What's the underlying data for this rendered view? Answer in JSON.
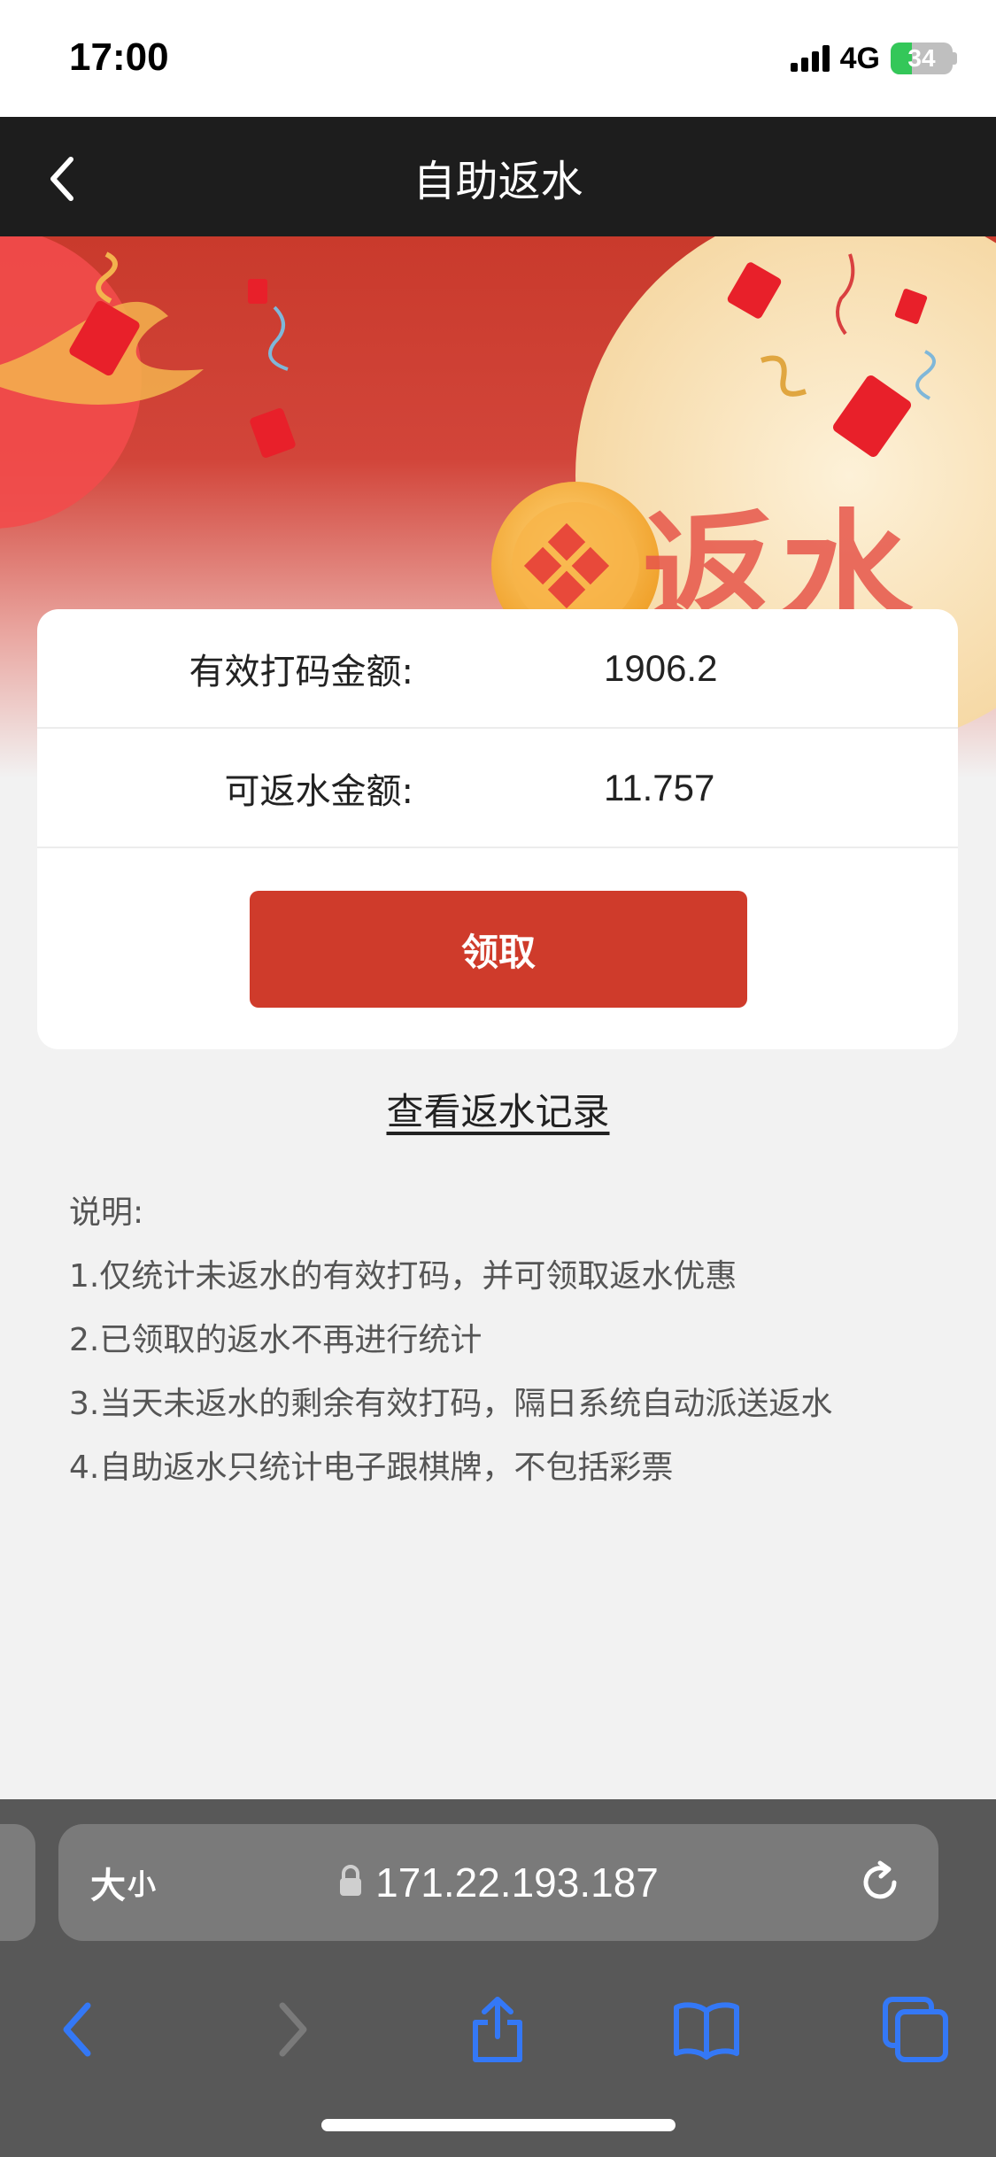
{
  "status_bar": {
    "time": "17:00",
    "network": "4G",
    "battery": "34",
    "battery_level": 0.34
  },
  "nav": {
    "title": "自助返水"
  },
  "banner": {
    "headline": "返水"
  },
  "card": {
    "rows": [
      {
        "label": "有效打码金额:",
        "value": "1906.2"
      },
      {
        "label": "可返水金额:",
        "value": "11.757"
      }
    ],
    "claim_label": "领取"
  },
  "records_link": "查看返水记录",
  "notes": {
    "title": "说明:",
    "items": [
      "1.仅统计未返水的有效打码，并可领取返水优惠",
      "2.已领取的返水不再进行统计",
      "3.当天未返水的剩余有效打码，隔日系统自动派送返水",
      "4.自助返水只统计电子跟棋牌，不包括彩票"
    ]
  },
  "safari": {
    "text_size_large": "大",
    "text_size_small": "小",
    "url": "171.22.193.187"
  },
  "colors": {
    "accent": "#cf3b2b",
    "nav_bg": "#1d1d1d",
    "link": "#3478f6"
  }
}
